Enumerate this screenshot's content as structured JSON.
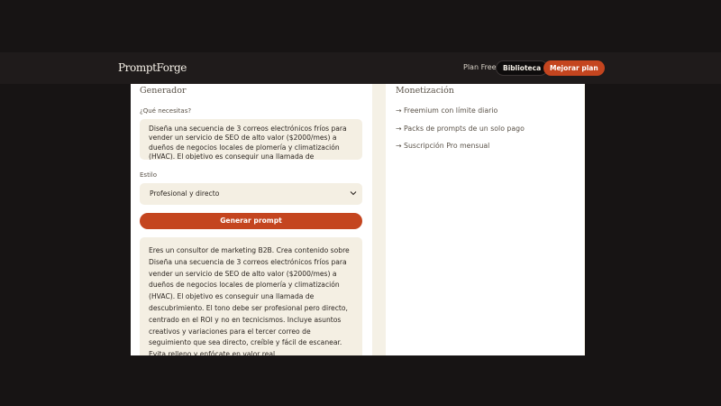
{
  "header": {
    "brand": "PromptForge",
    "plan_label": "Plan Free",
    "library_label": "Biblioteca",
    "upgrade_label": "Mejorar plan"
  },
  "generator": {
    "title": "Generador",
    "need_label": "¿Qué necesitas?",
    "need_value": "Diseña una secuencia de 3 correos electrónicos fríos para vender un servicio de SEO de alto valor ($2000/mes) a dueños de negocios locales de plomería y climatización (HVAC). El objetivo es conseguir una llamada de descubrimiento.",
    "style_label": "Estilo",
    "style_value": "Profesional y directo",
    "generate_label": "Generar prompt",
    "output": "Eres un consultor de marketing B2B. Crea contenido sobre Diseña una secuencia de 3 correos electrónicos fríos para vender un servicio de SEO de alto valor ($2000/mes) a dueños de negocios locales de plomería y climatización (HVAC). El objetivo es conseguir una llamada de descubrimiento. El tono debe ser profesional pero directo, centrado en el ROI y no en tecnicismos. Incluye asuntos creativos y variaciones para el tercer correo de seguimiento que sea directo, creíble y fácil de escanear. Evita relleno y enfócate en valor real."
  },
  "monetization": {
    "title": "Monetización",
    "items": [
      "→ Freemium con límite diario",
      "→ Packs de prompts de un solo pago",
      "→ Suscripción Pro mensual"
    ]
  },
  "colors": {
    "accent": "#c4451f",
    "navbar": "#1f1b1b",
    "page_bg": "#f5f1e6",
    "field_bg": "#f4efe3"
  }
}
